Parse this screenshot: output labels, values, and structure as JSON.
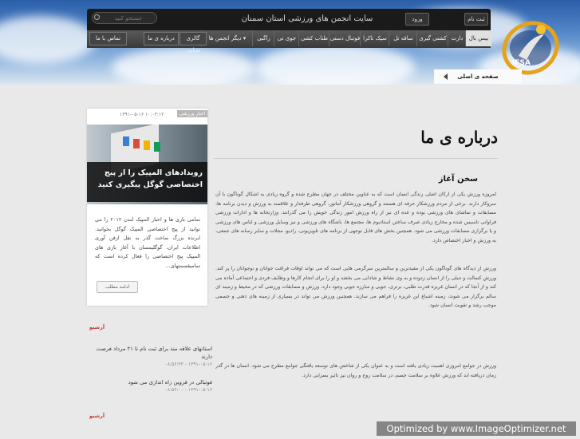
{
  "header": {
    "site_title": "سایت انجمن های ورزشی استان سمنان",
    "search_placeholder": "جستجو کنید",
    "signup_label": "ثبت نام",
    "login_label": "ورود",
    "logo_text": "IFSA"
  },
  "nav": {
    "items": [
      {
        "label": "بیس بال"
      },
      {
        "label": "دارت"
      },
      {
        "label": "کشتی گیری"
      },
      {
        "label": "ساقه تل"
      },
      {
        "label": "سپک تاکرا"
      },
      {
        "label": "فوتبال دستی"
      },
      {
        "label": "طناب کشی"
      },
      {
        "label": "جوی تی"
      },
      {
        "label": "راگبی"
      }
    ],
    "more_label": "دیگر انجمن ها",
    "row2": [
      {
        "label": "گالری تصاویر"
      },
      {
        "label": "درباره ی ما"
      },
      {
        "label": "تماس با ما"
      }
    ]
  },
  "breadcrumb": {
    "label": "صفحه ی اصلی"
  },
  "main": {
    "title": "درباره ی ما",
    "section_title": "سخن آغاز",
    "paragraphs": [
      "امروزه ورزش یکی از ارکان اصلی زندگی انسان است که به عناوین مختلف در جهان مطرح شده و گروه زیادی به اشکال گوناگون با آن سروکار دارند. برخی از مردم ورزشکار حرفه ای هستند و گروهی ورزشکار آماتور، گروهی طرفدار و علاقمند به ورزش و دیدن برنامه ها، مسابقات و تماشای های ورزشی بوده و عده ای نیز از راه ورزش امور زندگی خویش را می گذرانند. وزارتخانه ها و ادارات ورزشی فراوانی تاسیس شده و مخارج زیادی صرف ساختن استادیوم ها، مجتمع ها، باشگاه های ورزشی و نیز وسایل ورزشی و لباس های ورزشی و یا برگزاری مسابقات ورزشی می شود. همچنین بخش های قابل توجهی از برنامه های تلویزیونی، رادیو، مجلات و سایر رسانه های جمعی، به ورزش و اخبار اختصاص دارد.",
      "ورزش از دیدگاه های گوناگون یکی از مفیدترین و سالمترین سرگرمی هایی است که می تواند اوقات فراغت جوانان و نوجوانان را پر کند. ورزش کسالت و تنبلی را از انسان زدوده و به وی نشاط و شادابی می بخشد و او را برای انجام کارها و وظایف فردی و اجتماعی آماده می کند و از آنجا که در انسان غریزه قدرت طلبی، برتری، جویی و مبارزه جویی وجود دارد، ورزش و مسابقات ورزشی که در محیط و زمینه ای سالم برگزار می شوند، زمینه اشباع این غریزه را فراهم می سازند. همچنین ورزش می تواند در بسیاری از زمینه های ذهنی و جسمی موجب رشد و تقویت انسان شود.",
      "ورزش در جوامع امروزی اهمیت زیادی یافته است و به عنوان یکی از شاخص های توسعه یافتگی جوامع مطرح می شود. انسان ها در گذر زمان دریافته اند که ورزش علاوه بر سلامت جسم، در سلامت روح و روان نیز تاثیر بسزایی دارد."
    ]
  },
  "sidebar": {
    "card": {
      "tab_label": "اخبار ورزشی",
      "date": "۱۳۹۱-۰۵-۱۶ ۱۰:۰۳:۱۲",
      "image_caption": "رویدادهای المپیک را از پیج اختصاصی گوگل پیگیری کنید",
      "text": "تمامی بازی ها و اخبار المپیک لندن ۲۰۱۲ را می توانید از پیج اختصاصی المپیک گوگل بخوانید. ابرنده بزرگ ساخت گذر به نقل ازفن آوری اطلاعات ایران، گوگلیمسان با آغاز بازی های المپیک پیج اختصاصی را فعال کرده است که تمامیقسمتهای...",
      "more_label": "ادامه مطلب"
    },
    "list_head_1": "آرشیو",
    "items": [
      {
        "title": "استانهای علاقه مند برای ثبت نام تا ۲۱ مرداد فرصت دارند",
        "date": "۱۳۹۱-۰۵-۱۶ - ۰۸:۵۶:۳۳"
      },
      {
        "title": "فوتبالی در قزوین راه اندازی می شود",
        "date": "۱۳۹۱-۰۵-۱۶ - ۰۸:۵۶:۰۰"
      }
    ],
    "list_head_2": "آرشیو"
  },
  "watermark": "Optimized by www.ImageOptimizer.net",
  "colors": {
    "accent": "#c0392b",
    "nav_bg": "#3a3a3a",
    "page_bg": "#e9e9e9"
  }
}
